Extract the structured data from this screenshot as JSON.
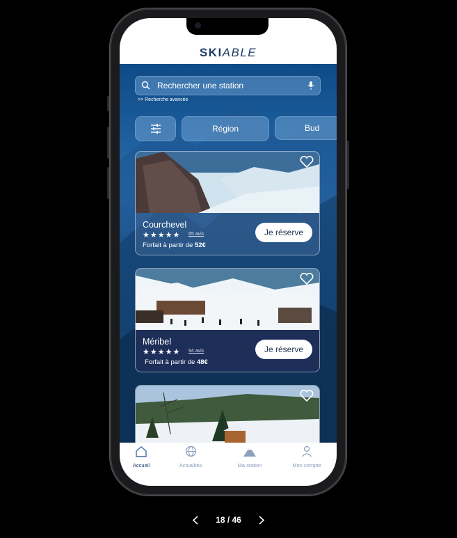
{
  "app": {
    "logo_bold": "SKI",
    "logo_light": "ABLE"
  },
  "search": {
    "placeholder": "Rechercher une station",
    "advanced_link": ">> Recherche avancée"
  },
  "filters": {
    "chips": [
      "Région",
      "Bud"
    ]
  },
  "stations": [
    {
      "name": "Courchevel",
      "rating": 5,
      "reviews": "65 avis",
      "price_prefix": "Forfait à partir de ",
      "price": "52€",
      "cta": "Je réserve"
    },
    {
      "name": "Méribel",
      "rating": 5,
      "reviews": "94 avis",
      "price_prefix": "Forfait à partir de ",
      "price": "48€",
      "cta": "Je réserve"
    }
  ],
  "tabbar": {
    "items": [
      {
        "label": "Accueil",
        "icon": "home-icon",
        "active": true
      },
      {
        "label": "Actualités",
        "icon": "globe-icon"
      },
      {
        "label": "Ma station",
        "icon": "mountain-icon"
      },
      {
        "label": "Mon compte",
        "icon": "user-icon"
      }
    ]
  },
  "pager": {
    "text": "18 / 46"
  },
  "colors": {
    "brand": "#1f3c66",
    "accent": "#0e4a86",
    "tab_inactive": "#8aa0bb"
  }
}
